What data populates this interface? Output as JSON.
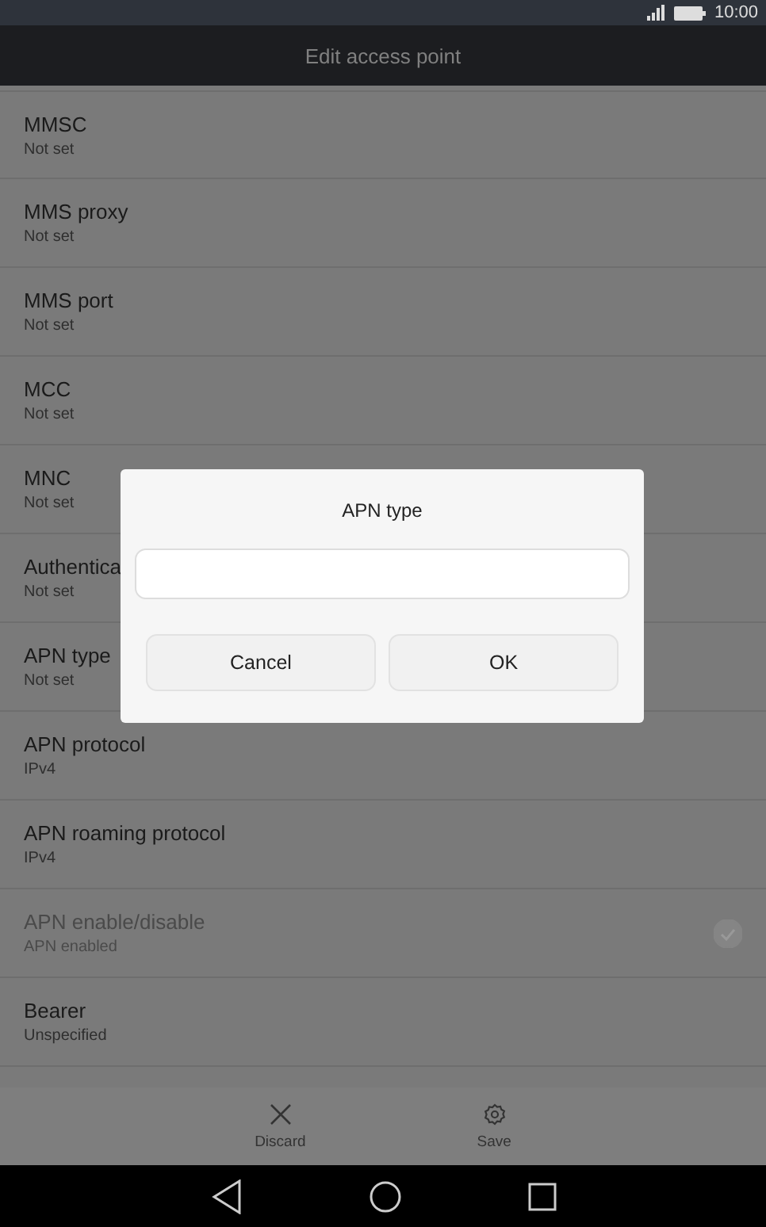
{
  "status_bar": {
    "time": "10:00"
  },
  "title_bar": {
    "title": "Edit access point"
  },
  "settings": [
    {
      "label": "MMSC",
      "value": "Not set",
      "disabled": false
    },
    {
      "label": "MMS proxy",
      "value": "Not set",
      "disabled": false
    },
    {
      "label": "MMS port",
      "value": "Not set",
      "disabled": false
    },
    {
      "label": "MCC",
      "value": "Not set",
      "disabled": false
    },
    {
      "label": "MNC",
      "value": "Not set",
      "disabled": false
    },
    {
      "label": "Authentica",
      "value": "Not set",
      "disabled": false
    },
    {
      "label": "APN type",
      "value": "Not set",
      "disabled": false
    },
    {
      "label": "APN protocol",
      "value": "IPv4",
      "disabled": false
    },
    {
      "label": "APN roaming protocol",
      "value": "IPv4",
      "disabled": false
    },
    {
      "label": "APN enable/disable",
      "value": "APN enabled",
      "disabled": true,
      "kind": "checkbox",
      "checked": true
    },
    {
      "label": "Bearer",
      "value": "Unspecified",
      "disabled": false
    }
  ],
  "actions": [
    {
      "label": "Discard",
      "kind": "close"
    },
    {
      "label": "Save",
      "kind": "gear"
    }
  ],
  "dialog": {
    "title": "APN type",
    "buttons": [
      "Cancel",
      "OK"
    ]
  }
}
